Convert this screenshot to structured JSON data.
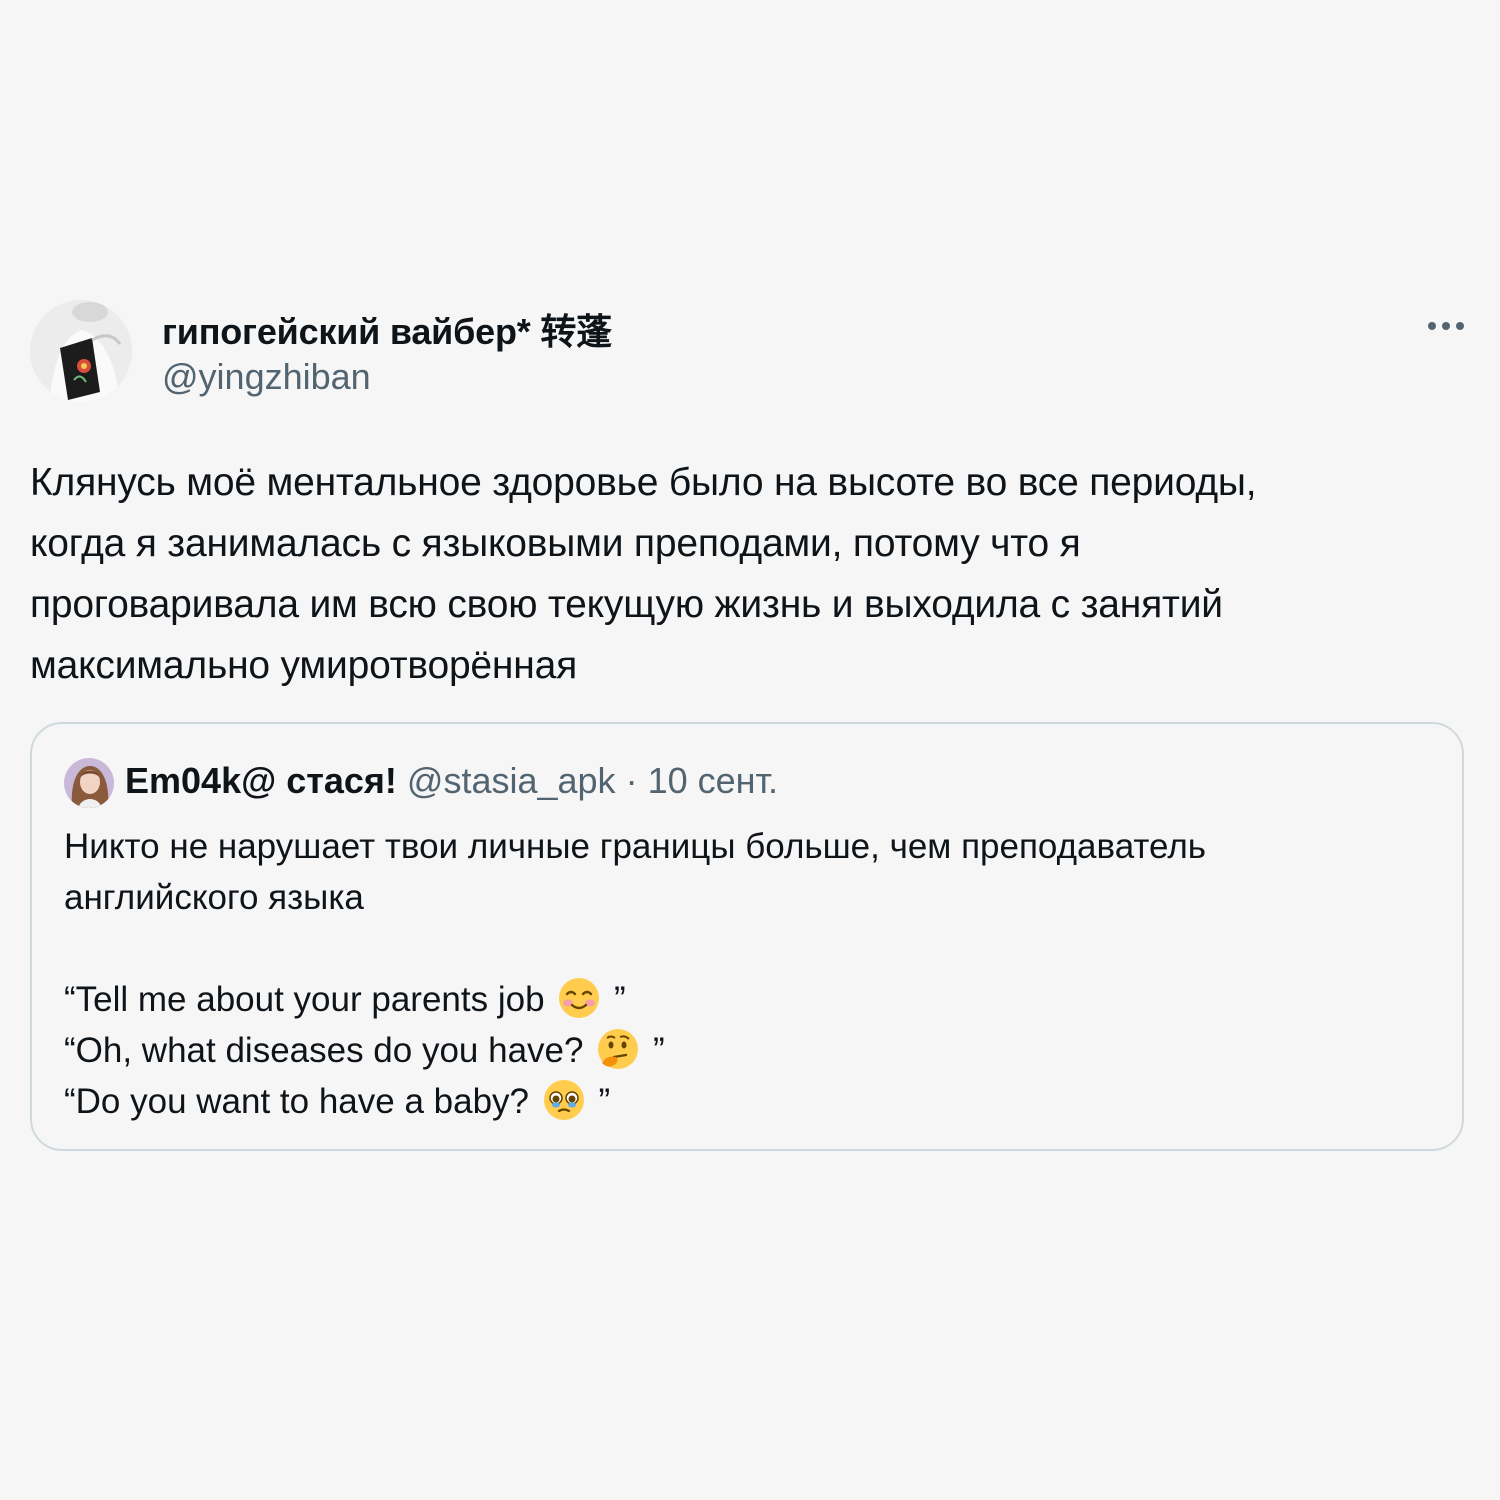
{
  "tweet": {
    "author": {
      "display_name": "гипогейский вайбер* 转蓬",
      "handle": "@yingzhiban"
    },
    "text_lines": [
      "Клянусь моё ментальное здоровье было на высоте во все периоды,",
      "когда я занималась с языковыми преподами, потому что я",
      "проговаривала им всю свою текущую жизнь и выходила с занятий",
      "максимально умиротворённая"
    ],
    "more_icon": "more-horizontal-icon"
  },
  "quote": {
    "author": {
      "display_name": "Em04k@ стася!",
      "handle": "@stasia_apk",
      "separator": "·",
      "date": "10 сент."
    },
    "text_lines": [
      "Никто не нарушает твои личные границы больше, чем преподаватель",
      "английского языка"
    ],
    "quotes": [
      {
        "text": "“Tell me about your parents job",
        "close": "”",
        "emoji": "smiling-face-icon"
      },
      {
        "text": "“Oh, what diseases do you have?",
        "close": "”",
        "emoji": "thinking-face-icon"
      },
      {
        "text": "“Do you want to have a baby?",
        "close": "”",
        "emoji": "pleading-face-icon"
      }
    ]
  },
  "colors": {
    "background": "#f6f6f7",
    "text": "#0f1419",
    "secondary_text": "#536471",
    "border": "#cfd9de"
  }
}
